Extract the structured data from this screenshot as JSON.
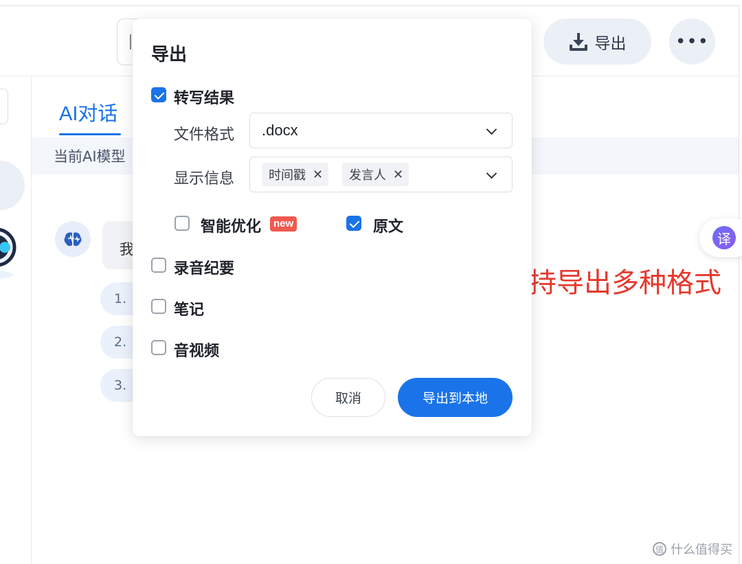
{
  "header": {
    "export_label": "导出",
    "more_label": "•••"
  },
  "tabs": {
    "ai_chat": "AI对话"
  },
  "model_bar": {
    "label": "当前AI模型"
  },
  "chat": {
    "bubble_text": "我",
    "suggestions": [
      "1. ",
      "2. ",
      "3. "
    ]
  },
  "translate": {
    "glyph": "译"
  },
  "export_dialog": {
    "title": "导出",
    "transcript": {
      "label": "转写结果",
      "checked": true
    },
    "file_format": {
      "label": "文件格式",
      "value": ".docx"
    },
    "display_info": {
      "label": "显示信息",
      "tags": [
        "时间戳",
        "发言人"
      ]
    },
    "smart_optimize": {
      "label": "智能优化",
      "badge": "new",
      "checked": false
    },
    "original": {
      "label": "原文",
      "checked": true
    },
    "recording_summary": {
      "label": "录音纪要",
      "checked": false
    },
    "notes": {
      "label": "笔记",
      "checked": false
    },
    "audio_video": {
      "label": "音视频",
      "checked": false
    },
    "cancel_label": "取消",
    "confirm_label": "导出到本地"
  },
  "annotation": {
    "text": "还支持导出多种格式"
  },
  "watermark": {
    "text": "什么值得买"
  },
  "colors": {
    "accent": "#1a73e8",
    "annotation": "#e6382d",
    "badge": "#f0594f"
  }
}
